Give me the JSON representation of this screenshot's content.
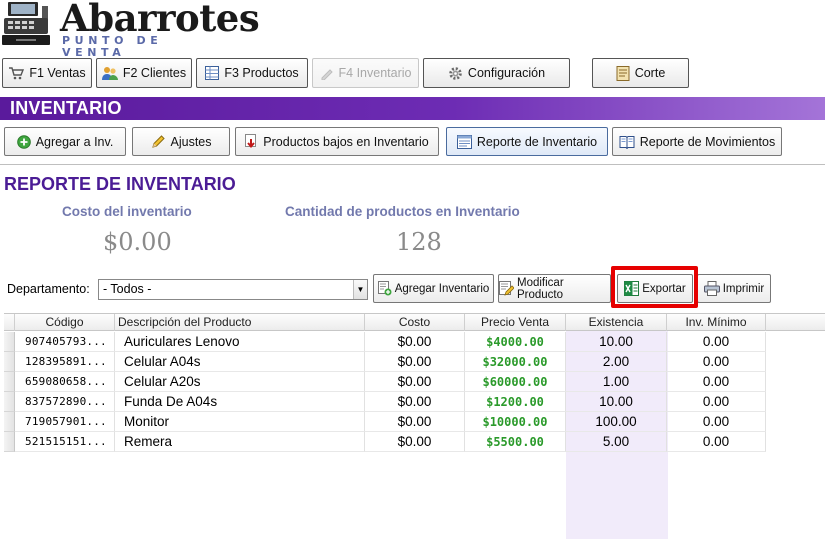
{
  "app": {
    "brand": "Abarrotes",
    "tagline": "PUNTO DE VENTA"
  },
  "topnav": [
    {
      "label": "F1 Ventas",
      "icon": "cart-icon",
      "enabled": true
    },
    {
      "label": "F2 Clientes",
      "icon": "users-icon",
      "enabled": true
    },
    {
      "label": "F3 Productos",
      "icon": "products-icon",
      "enabled": true
    },
    {
      "label": "F4 Inventario",
      "icon": "inventory-icon",
      "enabled": false
    },
    {
      "label": "Configuración",
      "icon": "gear-icon",
      "enabled": true
    },
    {
      "label": "Corte",
      "icon": "register-icon",
      "enabled": true
    }
  ],
  "section": {
    "title": "INVENTARIO",
    "accent_color": "#5a1a9c"
  },
  "subnav": [
    {
      "label": "Agregar a Inv.",
      "icon": "add-icon"
    },
    {
      "label": "Ajustes",
      "icon": "pencil-icon"
    },
    {
      "label": "Productos bajos en Inventario",
      "icon": "low-stock-icon"
    },
    {
      "label": "Reporte de Inventario",
      "icon": "report-icon",
      "active": true
    },
    {
      "label": "Reporte de Movimientos",
      "icon": "book-icon"
    }
  ],
  "report": {
    "title": "REPORTE DE INVENTARIO",
    "cost_label": "Costo del inventario",
    "cost_value": "$0.00",
    "count_label": "Cantidad de productos en Inventario",
    "count_value": "128"
  },
  "toolbar": {
    "dept_label": "Departamento:",
    "dept_value": "- Todos -",
    "buttons": [
      {
        "label": "Agregar Inventario",
        "icon": "add-inventory-icon"
      },
      {
        "label": "Modificar Producto",
        "icon": "edit-product-icon"
      },
      {
        "label": "Exportar",
        "icon": "excel-icon",
        "highlighted": true
      },
      {
        "label": "Imprimir",
        "icon": "printer-icon"
      }
    ]
  },
  "grid": {
    "columns": [
      "Código",
      "Descripción del Producto",
      "Costo",
      "Precio Venta",
      "Existencia",
      "Inv. Mínimo"
    ],
    "rows": [
      {
        "code": "907405793...",
        "desc": "Auriculares Lenovo",
        "cost": "$0.00",
        "price": "$4000.00",
        "stock": "10.00",
        "min": "0.00"
      },
      {
        "code": "128395891...",
        "desc": "Celular A04s",
        "cost": "$0.00",
        "price": "$32000.00",
        "stock": "2.00",
        "min": "0.00"
      },
      {
        "code": "659080658...",
        "desc": "Celular A20s",
        "cost": "$0.00",
        "price": "$60000.00",
        "stock": "1.00",
        "min": "0.00"
      },
      {
        "code": "837572890...",
        "desc": "Funda De A04s",
        "cost": "$0.00",
        "price": "$1200.00",
        "stock": "10.00",
        "min": "0.00"
      },
      {
        "code": "719057901...",
        "desc": "Monitor",
        "cost": "$0.00",
        "price": "$10000.00",
        "stock": "100.00",
        "min": "0.00"
      },
      {
        "code": "521515151...",
        "desc": "Remera",
        "cost": "$0.00",
        "price": "$5500.00",
        "stock": "5.00",
        "min": "0.00"
      }
    ],
    "price_color": "#2a9a2a",
    "stock_column_bg": "#f1ebfa"
  }
}
